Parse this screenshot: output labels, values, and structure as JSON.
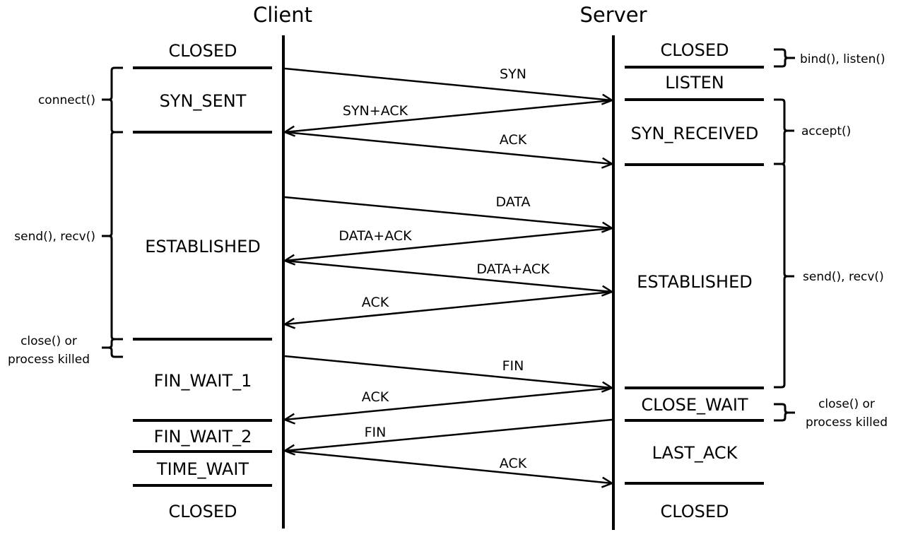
{
  "header": {
    "client_title": "Client",
    "server_title": "Server"
  },
  "client_states": [
    {
      "label": "CLOSED"
    },
    {
      "label": "SYN_SENT"
    },
    {
      "label": "ESTABLISHED"
    },
    {
      "label": "FIN_WAIT_1"
    },
    {
      "label": "FIN_WAIT_2"
    },
    {
      "label": "TIME_WAIT"
    },
    {
      "label": "CLOSED"
    }
  ],
  "server_states": [
    {
      "label": "CLOSED"
    },
    {
      "label": "LISTEN"
    },
    {
      "label": "SYN_RECEIVED"
    },
    {
      "label": "ESTABLISHED"
    },
    {
      "label": "CLOSE_WAIT"
    },
    {
      "label": "LAST_ACK"
    },
    {
      "label": "CLOSED"
    }
  ],
  "messages": [
    {
      "label": "SYN",
      "direction": "client-to-server"
    },
    {
      "label": "SYN+ACK",
      "direction": "server-to-client"
    },
    {
      "label": "ACK",
      "direction": "client-to-server"
    },
    {
      "label": "DATA",
      "direction": "client-to-server"
    },
    {
      "label": "DATA+ACK",
      "direction": "server-to-client"
    },
    {
      "label": "DATA+ACK",
      "direction": "client-to-server"
    },
    {
      "label": "ACK",
      "direction": "server-to-client"
    },
    {
      "label": "FIN",
      "direction": "client-to-server"
    },
    {
      "label": "ACK",
      "direction": "server-to-client"
    },
    {
      "label": "FIN",
      "direction": "server-to-client"
    },
    {
      "label": "ACK",
      "direction": "client-to-server"
    }
  ],
  "client_calls": [
    {
      "label": "connect()"
    },
    {
      "label": "send(), recv()"
    },
    {
      "line1": "close() or",
      "line2": "process killed"
    }
  ],
  "server_calls": [
    {
      "label": "bind(), listen()"
    },
    {
      "label": "accept()"
    },
    {
      "label": "send(), recv()"
    },
    {
      "line1": "close() or",
      "line2": "process killed"
    }
  ]
}
